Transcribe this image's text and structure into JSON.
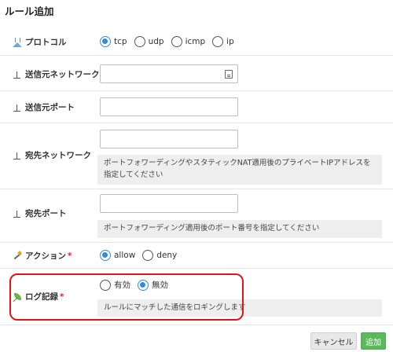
{
  "dialog": {
    "title": "ルール追加"
  },
  "protocol": {
    "label": "プロトコル",
    "options": [
      {
        "value": "tcp",
        "checked": true
      },
      {
        "value": "udp",
        "checked": false
      },
      {
        "value": "icmp",
        "checked": false
      },
      {
        "value": "ip",
        "checked": false
      }
    ]
  },
  "source_network": {
    "label": "送信元ネットワーク",
    "value": ""
  },
  "source_port": {
    "label": "送信元ポート",
    "value": ""
  },
  "dest_network": {
    "label": "宛先ネットワーク",
    "value": "",
    "help": "ポートフォワーディングやスタティックNAT適用後のプライベートIPアドレスを指定してください"
  },
  "dest_port": {
    "label": "宛先ポート",
    "value": "",
    "help": "ポートフォワーディング適用後のポート番号を指定してください"
  },
  "action": {
    "label": "アクション",
    "required_mark": "*",
    "options": [
      {
        "value": "allow",
        "checked": true
      },
      {
        "value": "deny",
        "checked": false
      }
    ]
  },
  "logging": {
    "label": "ログ記録",
    "required_mark": "*",
    "options": [
      {
        "value": "有効",
        "checked": false
      },
      {
        "value": "無効",
        "checked": true
      }
    ],
    "help": "ルールにマッチした通信をロギングします"
  },
  "footer": {
    "cancel_label": "キャンセル",
    "add_label": "追加"
  },
  "colors": {
    "accent": "#2f8fd6",
    "primary_button": "#5cb85c",
    "highlight": "#e2141b",
    "required": "#d9272e"
  },
  "icons": {
    "protocol": "flask-icon",
    "fields": "field-tee-icon",
    "action": "wand-icon",
    "logging": "leaf-icon",
    "input_keyboard": "keyboard-icon"
  }
}
